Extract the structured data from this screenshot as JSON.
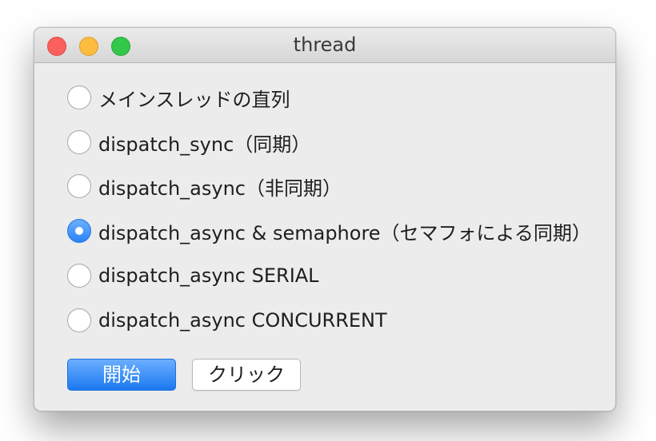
{
  "window": {
    "title": "thread"
  },
  "options": [
    {
      "label": "メインスレッドの直列",
      "selected": false
    },
    {
      "label": "dispatch_sync（同期）",
      "selected": false
    },
    {
      "label": "dispatch_async（非同期）",
      "selected": false
    },
    {
      "label": "dispatch_async & semaphore（セマフォによる同期）",
      "selected": true
    },
    {
      "label": "dispatch_async SERIAL",
      "selected": false
    },
    {
      "label": "dispatch_async CONCURRENT",
      "selected": false
    }
  ],
  "buttons": {
    "start_label": "開始",
    "click_label": "クリック"
  },
  "colors": {
    "accent": "#2a83f5",
    "close": "#fc605c",
    "minimize": "#fdbc40",
    "zoom": "#34c84a"
  }
}
